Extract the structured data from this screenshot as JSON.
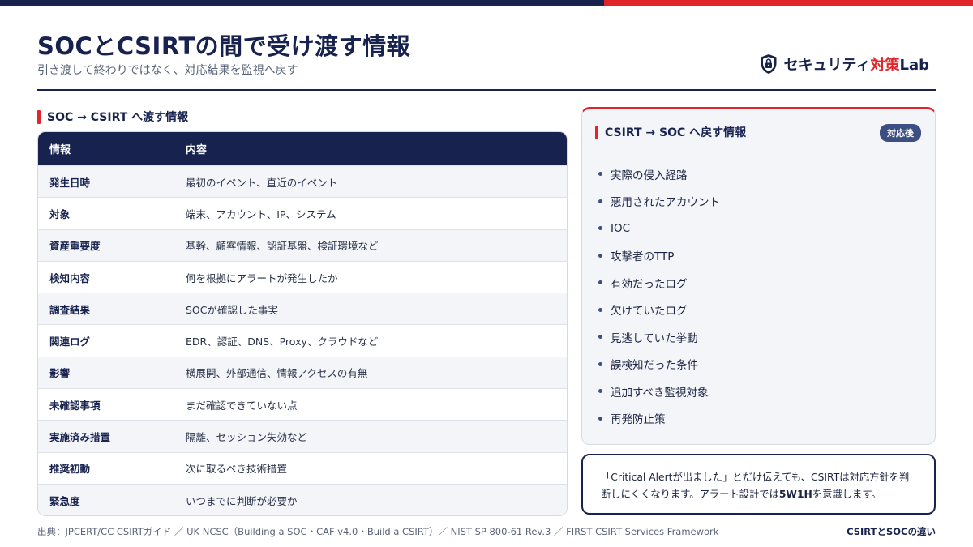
{
  "header": {
    "title": "SOCとCSIRTの間で受け渡す情報",
    "subtitle": "引き渡して終わりではなく、対応結果を監視へ戻す"
  },
  "brand": {
    "name_prefix": "セキュリティ",
    "name_accent": "対策",
    "name_suffix": "Lab",
    "icon": "shield-lock-icon"
  },
  "left_section": {
    "heading": "SOC → CSIRT へ渡す情報",
    "table": {
      "columns": [
        "情報",
        "内容"
      ],
      "rows": [
        [
          "発生日時",
          "最初のイベント、直近のイベント"
        ],
        [
          "対象",
          "端末、アカウント、IP、システム"
        ],
        [
          "資産重要度",
          "基幹、顧客情報、認証基盤、検証環境など"
        ],
        [
          "検知内容",
          "何を根拠にアラートが発生したか"
        ],
        [
          "調査結果",
          "SOCが確認した事実"
        ],
        [
          "関連ログ",
          "EDR、認証、DNS、Proxy、クラウドなど"
        ],
        [
          "影響",
          "横展開、外部通信、情報アクセスの有無"
        ],
        [
          "未確認事項",
          "まだ確認できていない点"
        ],
        [
          "実施済み措置",
          "隔離、セッション失効など"
        ],
        [
          "推奨初動",
          "次に取るべき技術措置"
        ],
        [
          "緊急度",
          "いつまでに判断が必要か"
        ]
      ]
    }
  },
  "right_panel": {
    "heading": "CSIRT → SOC へ戻す情報",
    "badge": "対応後",
    "items": [
      "実際の侵入経路",
      "悪用されたアカウント",
      "IOC",
      "攻撃者のTTP",
      "有効だったログ",
      "欠けていたログ",
      "見逃していた挙動",
      "誤検知だった条件",
      "追加すべき監視対象",
      "再発防止策"
    ]
  },
  "note": {
    "part1": "「Critical Alertが出ました」とだけ伝えても、CSIRTは対応方針を判断しにくくなります。アラート設計では",
    "emphasis": "5W1H",
    "part2": "を意識します。"
  },
  "footer": {
    "source": "出典：JPCERT/CC CSIRTガイド ／ UK NCSC（Building a SOC・CAF v4.0・Build a CSIRT）／ NIST SP 800-61 Rev.3 ／ FIRST CSIRT Services Framework",
    "page_label": "CSIRTとSOCの違い"
  },
  "colors": {
    "navy": "#17224f",
    "red": "#e0262b",
    "badge": "#3d4f82",
    "panel_bg": "#f3f5f9"
  }
}
